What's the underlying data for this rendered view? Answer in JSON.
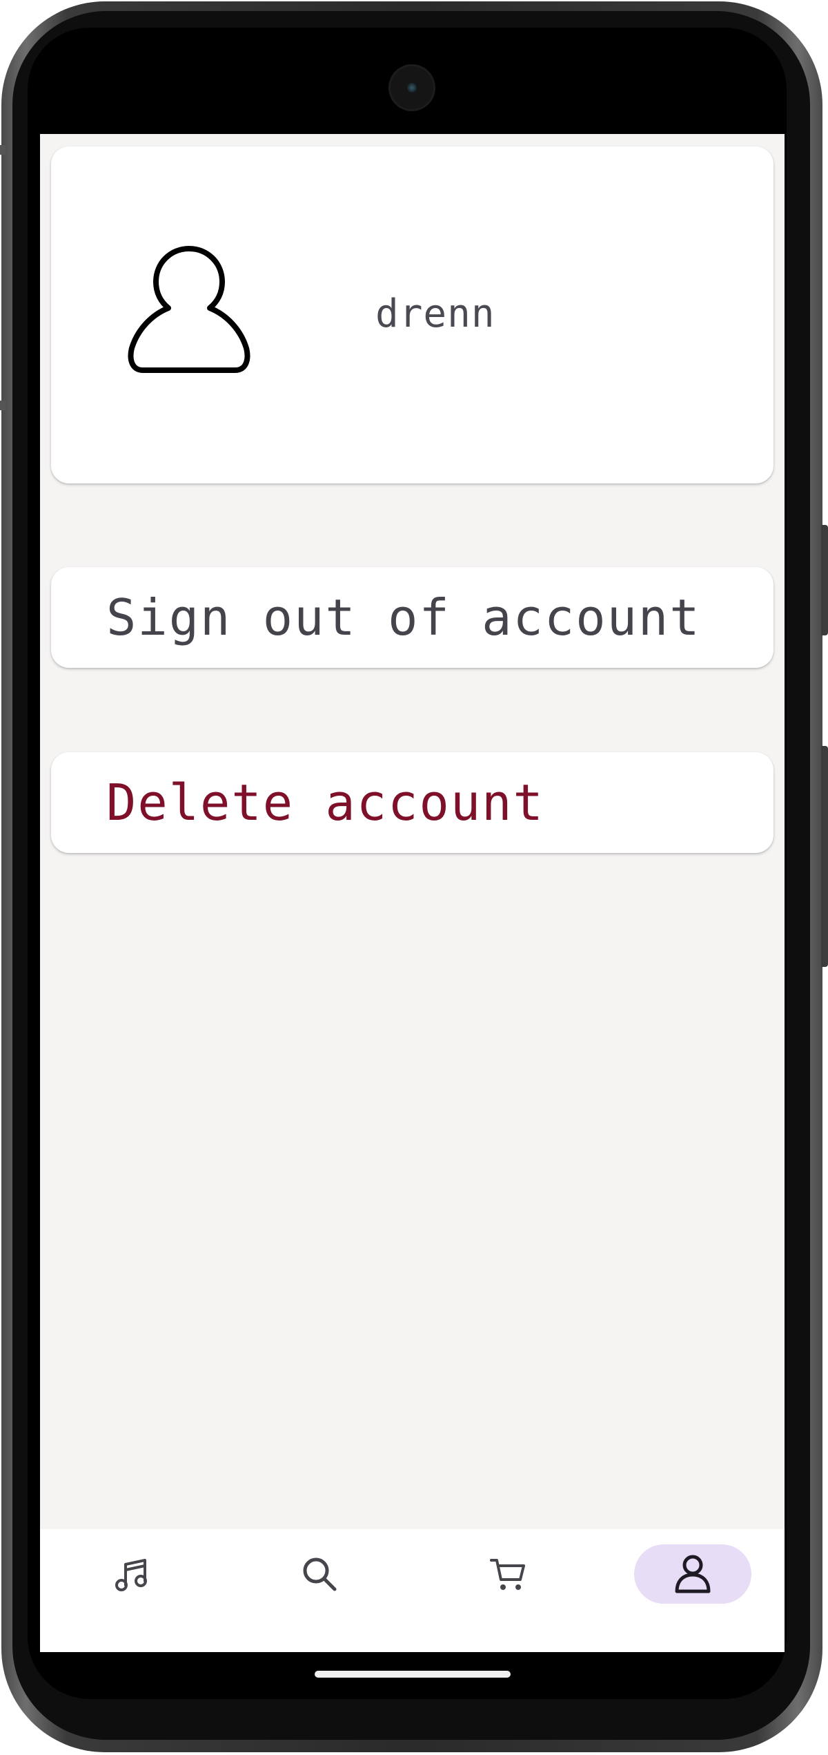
{
  "profile": {
    "username": "drenn",
    "avatar_icon": "person-outline-icon"
  },
  "actions": {
    "sign_out_label": "Sign out of account",
    "delete_label": "Delete account",
    "delete_color": "#7f1029"
  },
  "bottom_nav": {
    "items": [
      {
        "name": "music",
        "icon": "music-note-icon",
        "active": false
      },
      {
        "name": "search",
        "icon": "search-icon",
        "active": false
      },
      {
        "name": "cart",
        "icon": "cart-icon",
        "active": false
      },
      {
        "name": "account",
        "icon": "person-icon",
        "active": true
      }
    ],
    "active_color": "#e7ddf6"
  },
  "colors": {
    "background": "#f5f4f3",
    "card": "#ffffff",
    "text": "#45444c"
  }
}
